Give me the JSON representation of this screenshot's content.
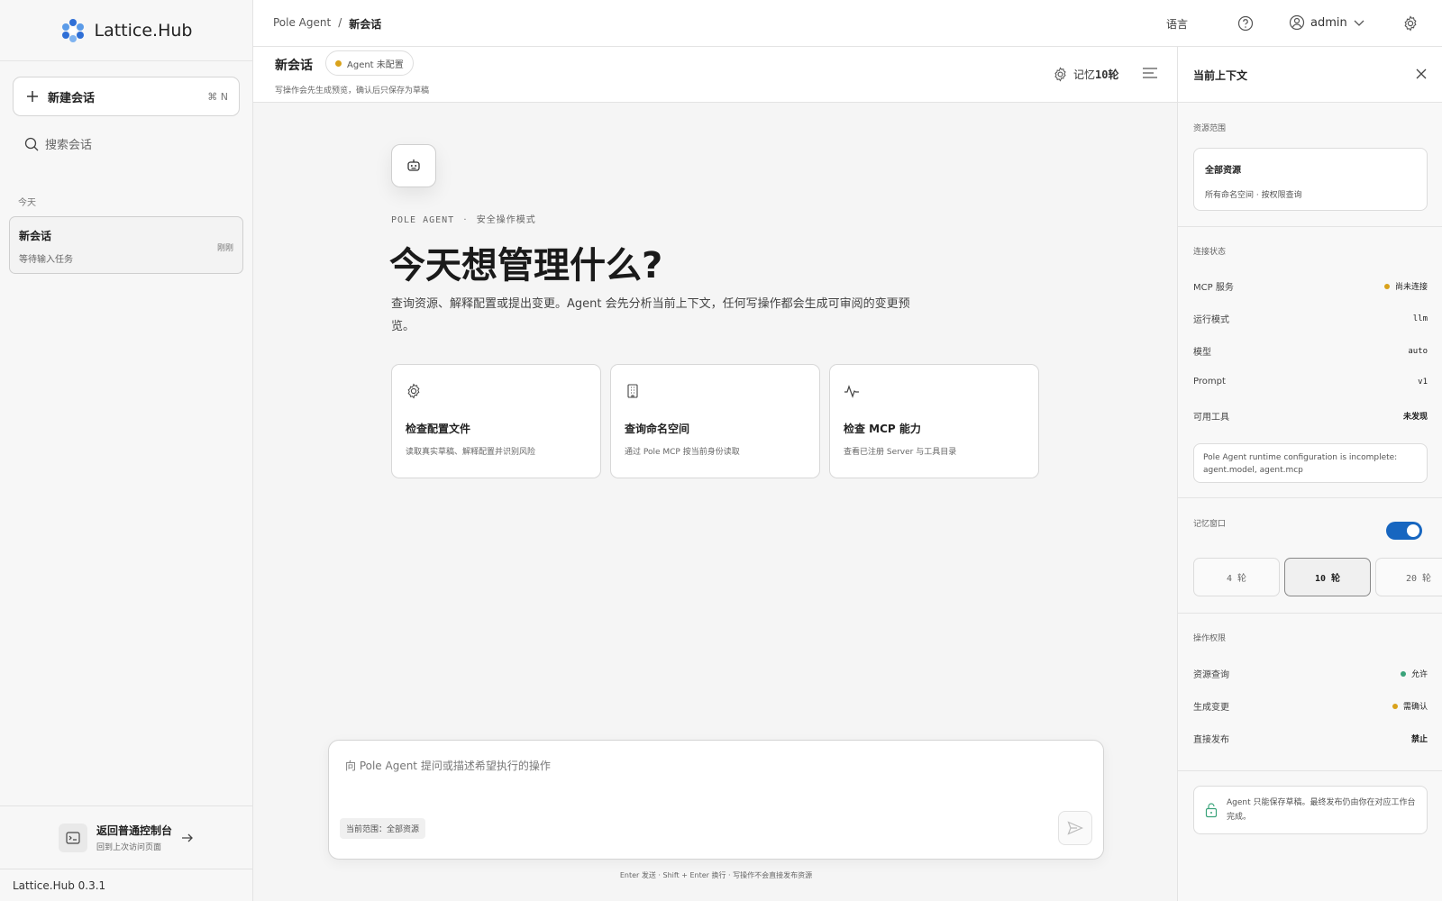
{
  "app": {
    "name": "Lattice.Hub",
    "version": "Lattice.Hub 0.3.1"
  },
  "sidebar": {
    "new_chat_label": "新建会话",
    "new_chat_shortcut": "⌘ N",
    "search_placeholder": "搜索会话",
    "group_today": "今天",
    "sessions": [
      {
        "title": "新会话",
        "subtitle": "等待输入任务",
        "time": "刚刚"
      }
    ],
    "back": {
      "title": "返回普通控制台",
      "subtitle": "回到上次访问页面"
    }
  },
  "header": {
    "breadcrumb": [
      "Pole Agent",
      "/",
      "新会话"
    ],
    "language": "语言",
    "user": "admin"
  },
  "conversation": {
    "title": "新会话",
    "badge": "Agent 未配置",
    "subtitle": "写操作会先生成预览，确认后只保存为草稿",
    "memory_label": "记忆",
    "memory_value": "10轮"
  },
  "hero": {
    "kicker_mono": "POLE AGENT",
    "kicker_sep": "·",
    "kicker_text": "安全操作模式",
    "title": "今天想管理什么?",
    "description": "查询资源、解释配置或提出变更。Agent 会先分析当前上下文，任何写操作都会生成可审阅的变更预览。"
  },
  "cards": [
    {
      "icon": "gear-icon",
      "title": "检查配置文件",
      "subtitle": "读取真实草稿、解释配置并识别风险"
    },
    {
      "icon": "building-icon",
      "title": "查询命名空间",
      "subtitle": "通过 Pole MCP 按当前身份读取"
    },
    {
      "icon": "activity-icon",
      "title": "检查 MCP 能力",
      "subtitle": "查看已注册 Server 与工具目录"
    }
  ],
  "composer": {
    "placeholder": "向 Pole Agent 提问或描述希望执行的操作",
    "scope_chip": "当前范围：全部资源",
    "hint": "Enter 发送 · Shift + Enter 换行 · 写操作不会直接发布资源"
  },
  "context_panel": {
    "title": "当前上下文",
    "scope_label": "资源范围",
    "scope_title": "全部资源",
    "scope_desc": "所有命名空间 · 按权限查询",
    "connection_label": "连接状态",
    "connection": [
      {
        "key": "MCP 服务",
        "value": "尚未连接",
        "status_color": "#d9a21b"
      },
      {
        "key": "运行模式",
        "value": "llm"
      },
      {
        "key": "模型",
        "value": "auto"
      },
      {
        "key": "Prompt",
        "value": "v1"
      },
      {
        "key": "可用工具",
        "value": "未发现"
      }
    ],
    "config_warning": "Pole Agent runtime configuration is incomplete: agent.model, agent.mcp",
    "memory_window_label": "记忆窗口",
    "memory_window_enabled": true,
    "memory_rounds": [
      "4 轮",
      "10 轮",
      "20 轮"
    ],
    "memory_selected": "10 轮",
    "permissions_label": "操作权限",
    "permissions": [
      {
        "key": "资源查询",
        "value": "允许",
        "status_color": "#3aa37a"
      },
      {
        "key": "生成变更",
        "value": "需确认",
        "status_color": "#d9a21b"
      },
      {
        "key": "直接发布",
        "value": "禁止"
      }
    ],
    "note": "Agent 只能保存草稿。最终发布仍由你在对应工作台完成。"
  },
  "colors": {
    "accent": "#1766c0",
    "warning": "#d9a21b",
    "ok": "#3aa37a"
  }
}
